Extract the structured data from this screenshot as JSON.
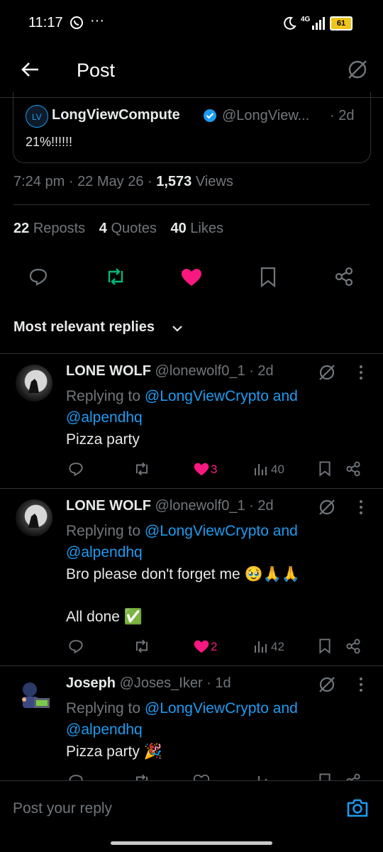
{
  "status_bar": {
    "time": "11:17",
    "more": "···",
    "network": "4G",
    "battery": "61"
  },
  "header": {
    "title": "Post"
  },
  "quoted_post": {
    "author_name": "LongViewCompute",
    "handle": "@LongView...",
    "age": "· 2d",
    "text": "21%!!!!!!"
  },
  "post_meta": {
    "time": "7:24 pm",
    "date": "22 May 26",
    "views_count": "1,573",
    "views_label": "Views",
    "sep": "·"
  },
  "engagement": {
    "reposts_count": "22",
    "reposts_label": "Reposts",
    "quotes_count": "4",
    "quotes_label": "Quotes",
    "likes_count": "40",
    "likes_label": "Likes"
  },
  "sort": {
    "label": "Most relevant replies"
  },
  "replies": [
    {
      "name": "LONE WOLF",
      "handle": "@lonewolf0_1",
      "age": "· 2d",
      "replying_prefix": "Replying to",
      "replying_to_1": "@LongViewCrypto and",
      "replying_to_2": "@alpendhq",
      "text": "Pizza party",
      "text2": "",
      "likes": "3",
      "views": "40"
    },
    {
      "name": "LONE WOLF",
      "handle": "@lonewolf0_1",
      "age": "· 2d",
      "replying_prefix": "Replying to",
      "replying_to_1": "@LongViewCrypto and",
      "replying_to_2": "@alpendhq",
      "text": "Bro please don't forget me 🥹🙏🙏",
      "text2": "All done ✅",
      "likes": "2",
      "views": "42"
    },
    {
      "name": "Joseph",
      "handle": "@Joses_Iker",
      "age": "· 1d",
      "replying_prefix": "Replying to",
      "replying_to_1": "@LongViewCrypto and",
      "replying_to_2": "@alpendhq",
      "text": "Pizza party 🎉",
      "text2": "",
      "likes": "",
      "views": ""
    }
  ],
  "composer": {
    "placeholder": "Post your reply"
  },
  "colors": {
    "background": "#000000",
    "accent": "#1d9bf0",
    "like": "#f91880",
    "repost": "#00ba7c",
    "muted": "#71767b"
  }
}
